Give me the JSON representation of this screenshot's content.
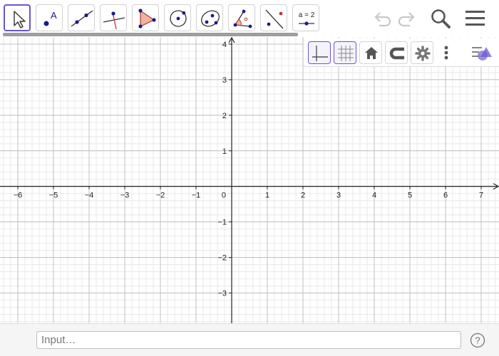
{
  "toolbar": {
    "tools": [
      {
        "name": "move-tool-icon",
        "selected": true
      },
      {
        "name": "point-tool-icon",
        "label": "A"
      },
      {
        "name": "line-tool-icon"
      },
      {
        "name": "perpendicular-line-tool-icon"
      },
      {
        "name": "polygon-tool-icon"
      },
      {
        "name": "circle-tool-icon"
      },
      {
        "name": "conic-tool-icon"
      },
      {
        "name": "angle-tool-icon"
      },
      {
        "name": "reflect-tool-icon"
      },
      {
        "name": "slider-tool-icon",
        "label": "a = 2"
      }
    ],
    "actions": [
      "undo-icon",
      "redo-icon",
      "search-icon",
      "menu-icon"
    ]
  },
  "style_bar": {
    "buttons": [
      {
        "name": "axes-toggle-icon",
        "active": true
      },
      {
        "name": "grid-toggle-icon",
        "active": true
      },
      {
        "name": "home-icon",
        "active": false
      },
      {
        "name": "magnet-icon",
        "active": false
      },
      {
        "name": "settings-icon",
        "active": false
      },
      {
        "name": "more-options-icon",
        "active": false
      },
      {
        "name": "style-bar-toggle-icon",
        "active": false
      }
    ]
  },
  "graph": {
    "x_range": [
      -6.5,
      7.5
    ],
    "y_range": [
      -3.85,
      4.2
    ],
    "x_ticks": [
      -6,
      -5,
      -4,
      -3,
      -2,
      -1,
      1,
      2,
      3,
      4,
      5,
      6,
      7
    ],
    "y_ticks": [
      -3,
      -2,
      -1,
      1,
      2,
      3,
      4
    ],
    "origin_label": "0",
    "major_grid_step": 1,
    "minor_grid_step": 0.2,
    "grid": true,
    "axes": true
  },
  "input_bar": {
    "placeholder": "Input…",
    "help_icon": "help-icon"
  },
  "colors": {
    "accent": "#6557d2",
    "point": "#1a1a8c",
    "polygon_fill": "#f4b0a0",
    "major_grid": "#c0c0c0",
    "minor_grid": "#e8e8e8",
    "axis": "#222222",
    "icon_gray": "#555555"
  }
}
